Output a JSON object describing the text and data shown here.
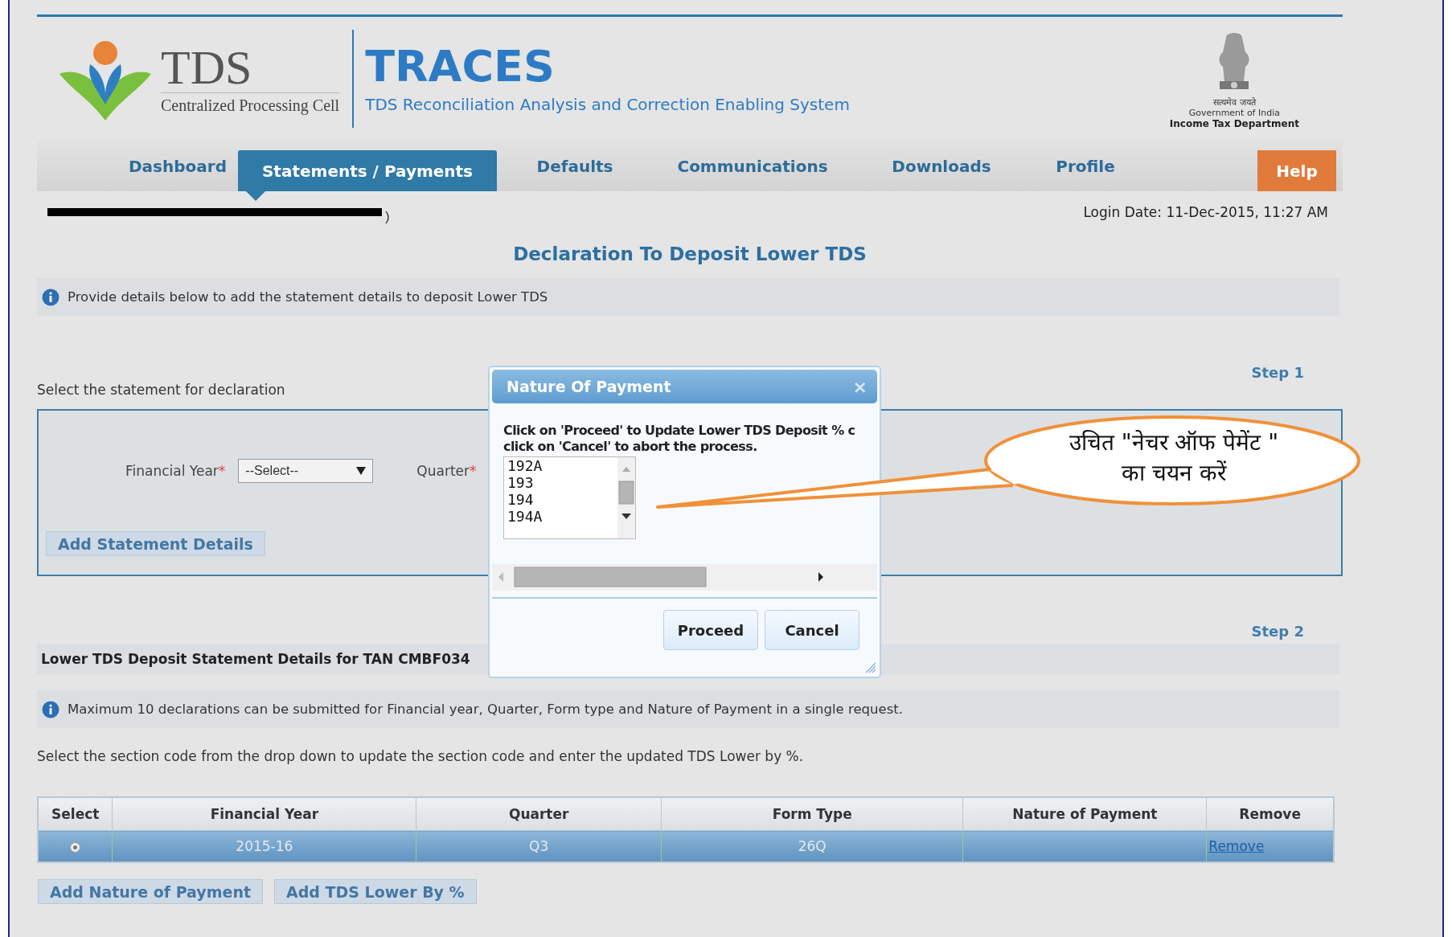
{
  "header": {
    "logo_text": "TDS",
    "logo_subtitle": "Centralized Processing Cell",
    "app_name": "TRACES",
    "app_tagline": "TDS Reconciliation Analysis and Correction Enabling System",
    "emblem_motto": "सत्यमेव जयते",
    "emblem_line_1": "Government of India",
    "emblem_line_2": "Income Tax Department"
  },
  "nav": {
    "tabs": [
      {
        "label": "Dashboard",
        "selected": false
      },
      {
        "label": "Statements / Payments",
        "selected": true
      },
      {
        "label": "Defaults",
        "selected": false
      },
      {
        "label": "Communications",
        "selected": false
      },
      {
        "label": "Downloads",
        "selected": false
      },
      {
        "label": "Profile",
        "selected": false
      }
    ],
    "help": "Help"
  },
  "welcome_suffix": ")",
  "login_date": "Login Date: 11-Dec-2015, 11:27 AM",
  "page_title": "Declaration To Deposit Lower TDS",
  "info_1": "Provide details below to add the statement details to deposit Lower TDS",
  "step_1": "Step 1",
  "statement_prompt": "Select the statement for declaration",
  "statement_form": {
    "financial_year_label": "Financial Year",
    "required_mark": "*",
    "financial_year_value": "--Select--",
    "quarter_label": "Quarter",
    "quarter_required_mark": "*",
    "add_button": "Add Statement Details"
  },
  "step_2": "Step 2",
  "details_heading": "Lower TDS Deposit Statement Details for TAN CMBF034",
  "info_2": "Maximum 10 declarations can be submitted for Financial year, Quarter, Form type and Nature of Payment in a single request.",
  "instruction": "Select the section code from the drop down to update the section code and enter the updated TDS Lower by %.",
  "table": {
    "columns": [
      "Select",
      "Financial Year",
      "Quarter",
      "Form Type",
      "Nature of Payment",
      "Remove"
    ],
    "rows": [
      {
        "selected": true,
        "financial_year": "2015-16",
        "quarter": "Q3",
        "form_type": "26Q",
        "remove": "Remove"
      }
    ]
  },
  "buttons": [
    "Add Nature of Payment",
    "Add TDS Lower By %"
  ],
  "dialog": {
    "title": "Nature Of Payment",
    "close": "×",
    "message_lines": [
      "Click on 'Proceed' to Update Lower TDS Deposit % c",
      "click on 'Cancel' to abort the process."
    ],
    "options": [
      {
        "label": "192A",
        "selected": false
      },
      {
        "label": "193",
        "selected": false
      },
      {
        "label": "194",
        "selected": false
      },
      {
        "label": "194A",
        "selected": false
      }
    ],
    "buttons": [
      "Proceed",
      "Cancel"
    ]
  },
  "callout": {
    "text": "उचित \"नेचर ऑफ पेमेंट \" का चयन करें"
  }
}
